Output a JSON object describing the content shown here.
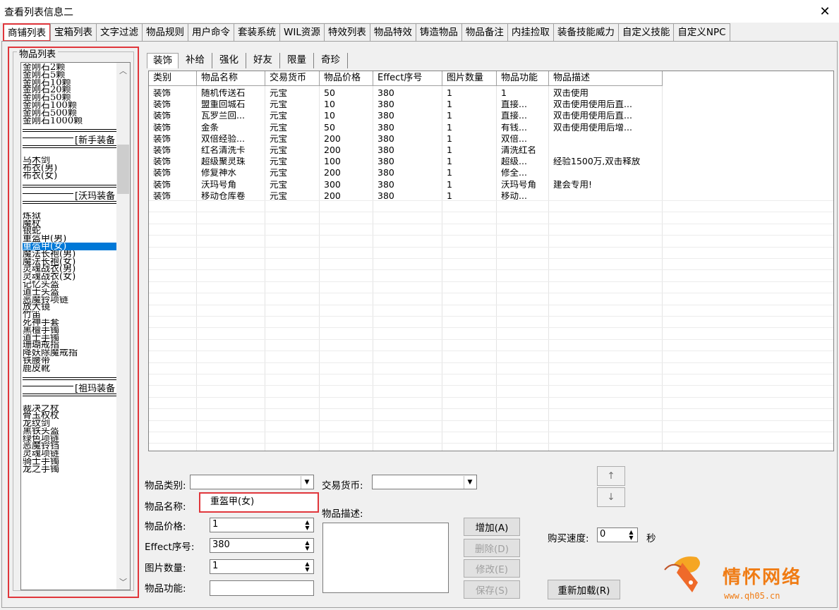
{
  "window": {
    "title": "查看列表信息二",
    "close_icon": "✕"
  },
  "main_tabs": [
    "商铺列表",
    "宝箱列表",
    "文字过滤",
    "物品规则",
    "用户命令",
    "套装系统",
    "WIL资源",
    "特效列表",
    "物品特效",
    "铸造物品",
    "物品备注",
    "内挂捡取",
    "装备技能威力",
    "自定义技能",
    "自定义NPC"
  ],
  "item_list": {
    "label": "物品列表",
    "groups": [
      {
        "items": [
          "金刚石2颗",
          "金刚石5颗",
          "金刚石10颗",
          "金刚石20颗",
          "金刚石50颗",
          "金刚石100颗",
          "金刚石500颗",
          "金刚石1000颗"
        ]
      },
      {
        "separator": "[新手装备",
        "items": [
          "乌木剑",
          "布衣(男)",
          "布衣(女)"
        ]
      },
      {
        "separator": "[沃玛装备",
        "items": [
          "炼狱",
          "魔杖",
          "银蛇",
          "重盔甲(男)",
          "重盔甲(女)",
          "魔法长袍(男)",
          "魔法长袍(女)",
          "灵魂战衣(男)",
          "灵魂战衣(女)",
          "记忆头盔",
          "道士头盔",
          "恶魔铃项链",
          "放大镜",
          "竹笛",
          "死神手套",
          "黑檀手镯",
          "道士手镯",
          "珊瑚戒指",
          "降妖除魔戒指",
          "铁腰带",
          "鹿皮靴"
        ]
      },
      {
        "separator": "[祖玛装备",
        "items": [
          "裁决之杖",
          "骨玉权杖",
          "龙纹剑",
          "黑铁头盔",
          "绿色项链",
          "恶魔铃铛",
          "灵魂项链",
          "骑士手镯",
          "龙之手镯"
        ]
      }
    ],
    "selected": "重盔甲(女)"
  },
  "sub_tabs": [
    "装饰",
    "补给",
    "强化",
    "好友",
    "限量",
    "奇珍"
  ],
  "grid": {
    "columns": [
      "类别",
      "物品名称",
      "交易货币",
      "物品价格",
      "Effect序号",
      "图片数量",
      "物品功能",
      "物品描述"
    ],
    "rows": [
      [
        "装饰",
        "随机传送石",
        "元宝",
        "50",
        "380",
        "1",
        "1",
        "双击使用"
      ],
      [
        "装饰",
        "盟重回城石",
        "元宝",
        "10",
        "380",
        "1",
        "直接...",
        "双击使用使用后直..."
      ],
      [
        "装饰",
        "瓦罗兰回...",
        "元宝",
        "10",
        "380",
        "1",
        "直接...",
        "双击使用使用后直..."
      ],
      [
        "装饰",
        "金条",
        "元宝",
        "50",
        "380",
        "1",
        "有钱...",
        "双击使用使用后增..."
      ],
      [
        "装饰",
        "双倍经验...",
        "元宝",
        "200",
        "380",
        "1",
        "双倍...",
        ""
      ],
      [
        "装饰",
        "红名清洗卡",
        "元宝",
        "200",
        "380",
        "1",
        "清洗红名",
        ""
      ],
      [
        "装饰",
        "超级聚灵珠",
        "元宝",
        "100",
        "380",
        "1",
        "超级...",
        "经验1500万,双击释放"
      ],
      [
        "装饰",
        "修复神水",
        "元宝",
        "200",
        "380",
        "1",
        "修全...",
        ""
      ],
      [
        "装饰",
        "沃玛号角",
        "元宝",
        "300",
        "380",
        "1",
        "沃玛号角",
        "建会专用!"
      ],
      [
        "装饰",
        "移动仓库卷",
        "元宝",
        "200",
        "380",
        "1",
        "移动...",
        ""
      ]
    ]
  },
  "form": {
    "category_label": "物品类别:",
    "currency_label": "交易货币:",
    "name_label": "物品名称:",
    "name_value": "重盔甲(女)",
    "desc_label": "物品描述:",
    "price_label": "物品价格:",
    "price_value": "1",
    "effect_label": "Effect序号:",
    "effect_value": "380",
    "image_label": "图片数量:",
    "image_value": "1",
    "function_label": "物品功能:",
    "add_button": "增加(A)",
    "delete_button": "删除(D)",
    "modify_button": "修改(E)",
    "save_button": "保存(S)",
    "up_icon": "↑",
    "down_icon": "↓",
    "buy_speed_label": "购买速度:",
    "buy_speed_value": "0",
    "seconds_label": "秒",
    "reload_button": "重新加载(R)"
  },
  "logo": {
    "name": "情怀网络",
    "url": "www.qh05.cn"
  }
}
